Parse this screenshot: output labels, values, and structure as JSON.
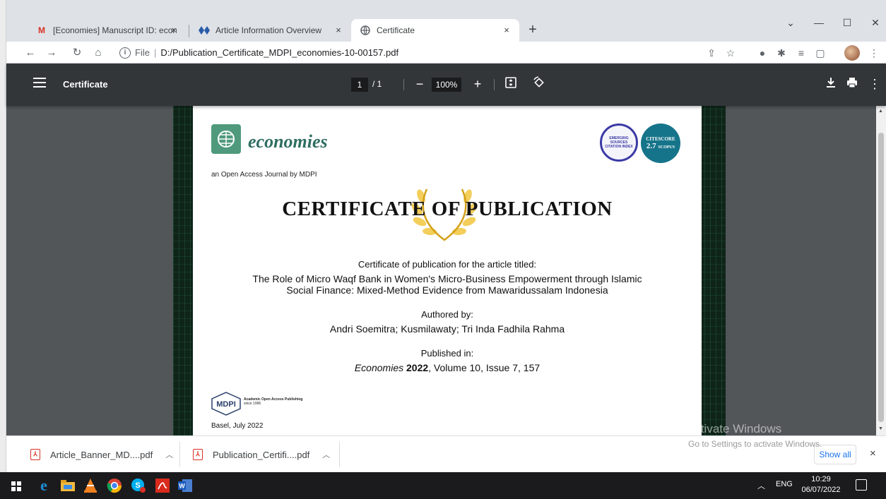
{
  "browser": {
    "tabs": [
      {
        "label": "[Economies] Manuscript ID: econ",
        "icon": "gmail-icon",
        "active": false
      },
      {
        "label": "Article Information Overview",
        "icon": "diamond-icon",
        "active": false
      },
      {
        "label": "Certificate",
        "icon": "globe-icon",
        "active": true
      }
    ],
    "close_glyph": "×",
    "new_tab_glyph": "+",
    "address": {
      "file_label": "File",
      "separator": "|",
      "url": "D:/Publication_Certificate_MDPI_economies-10-00157.pdf"
    }
  },
  "pdf_viewer": {
    "title": "Certificate",
    "current_page": "1",
    "page_total": "/ 1",
    "zoom": "100%",
    "zoom_out_glyph": "−",
    "zoom_in_glyph": "+"
  },
  "certificate": {
    "journal_name": "economies",
    "tagline": "an Open Access Journal by MDPI",
    "esci_badge": "EMERGING SOURCES CITATION INDEX",
    "citescore_label": "CITESCORE",
    "citescore_value": "2.7",
    "citescore_source": "SCOPUS",
    "heading": "CERTIFICATE OF PUBLICATION",
    "intro": "Certificate of publication for the article titled:",
    "article_title_line1": "The Role of Micro Waqf Bank in Women's Micro-Business Empowerment through Islamic",
    "article_title_line2": "Social Finance: Mixed-Method Evidence from Mawaridussalam Indonesia",
    "authored_label": "Authored by:",
    "authors": "Andri Soemitra; Kusmilawaty; Tri Inda Fadhila Rahma",
    "published_label": "Published in:",
    "journal_italic": "Economies",
    "year": "2022",
    "volume_issue": ", Volume 10, Issue 7, 157",
    "publisher_tagline_1": "Academic Open Access Publishing",
    "publisher_tagline_2": "since 1996",
    "place_date": "Basel, July 2022"
  },
  "watermark": {
    "title": "Activate Windows",
    "subtitle": "Go to Settings to activate Windows."
  },
  "downloads": {
    "items": [
      {
        "name": "Article_Banner_MD....pdf"
      },
      {
        "name": "Publication_Certifi....pdf"
      }
    ],
    "show_all": "Show all",
    "close_glyph": "×"
  },
  "taskbar": {
    "language": "ENG",
    "time": "10:29",
    "date": "06/07/2022"
  }
}
